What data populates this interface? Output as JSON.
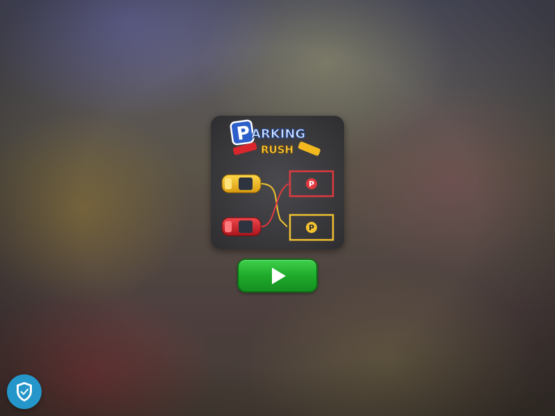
{
  "game": {
    "title_line1": "ARKING",
    "title_letter": "P",
    "title_line2": "RUSH",
    "parking_symbol": "P"
  },
  "colors": {
    "play_button": "#1faa2b",
    "shield_badge": "#2596c9",
    "red_slot": "#e03a3e",
    "yellow_slot": "#f2c230"
  },
  "icons": {
    "play": "play-icon",
    "security": "shield-check-icon"
  }
}
